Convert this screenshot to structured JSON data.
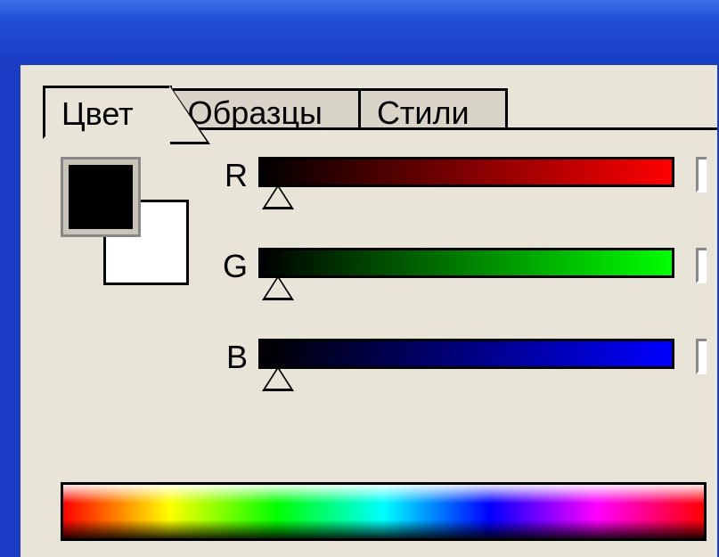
{
  "tabs": {
    "color": "Цвет",
    "swatches": "Образцы",
    "styles": "Стили"
  },
  "sliders": {
    "r": {
      "label": "R",
      "value": 0
    },
    "g": {
      "label": "G",
      "value": 0
    },
    "b": {
      "label": "B",
      "value": 0
    }
  },
  "colors": {
    "foreground": "#000000",
    "background": "#ffffff"
  }
}
